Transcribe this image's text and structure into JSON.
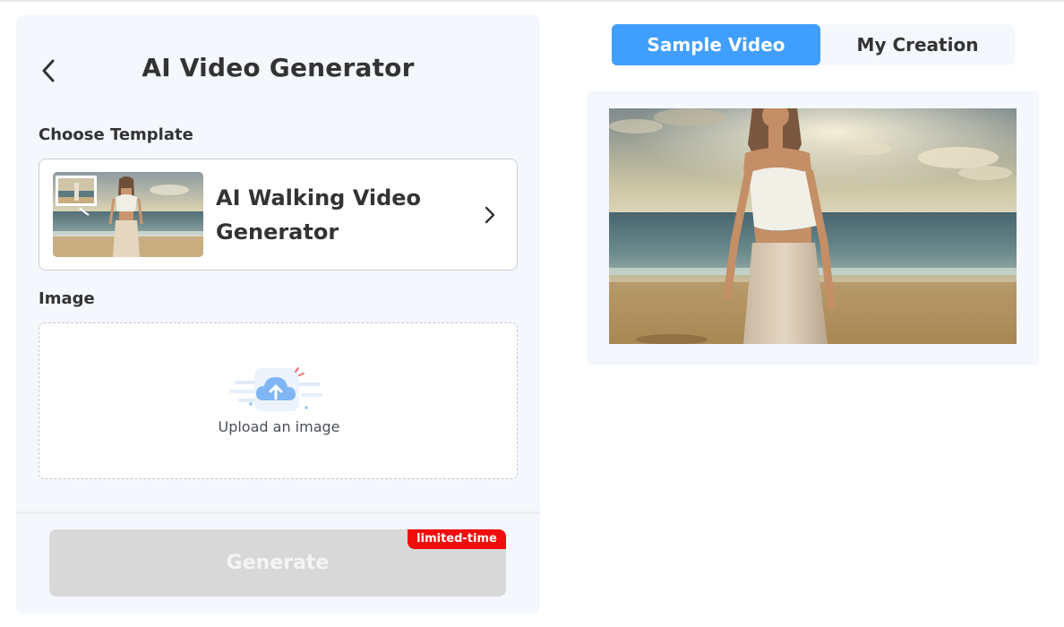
{
  "generator": {
    "title": "AI Video Generator",
    "choose_template_label": "Choose Template",
    "template": {
      "name": "AI Walking Video Generator"
    },
    "image_label": "Image",
    "upload_text": "Upload an image",
    "generate_label": "Generate",
    "promo_badge": "limited-time"
  },
  "tabs": [
    {
      "label": "Sample Video",
      "active": true
    },
    {
      "label": "My Creation",
      "active": false
    }
  ],
  "colors": {
    "accent": "#409eff",
    "panel_bg": "#f4f7fb",
    "badge_red": "#f20d0d",
    "disabled_button": "#d8d8d8"
  },
  "icons": {
    "back": "chevron-left-icon",
    "template_open": "chevron-right-icon",
    "upload": "cloud-upload-icon"
  }
}
